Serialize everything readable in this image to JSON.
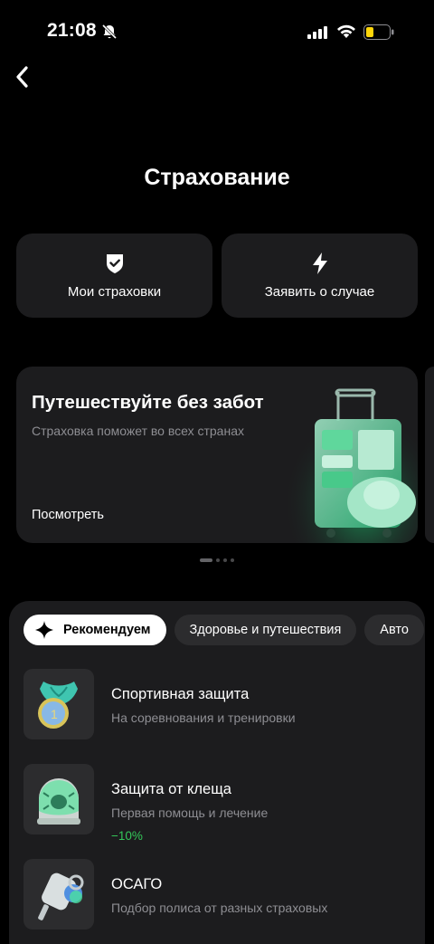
{
  "status": {
    "time": "21:08"
  },
  "page": {
    "title": "Страхование"
  },
  "actions": [
    {
      "label": "Мои страховки",
      "icon": "shield-check-icon"
    },
    {
      "label": "Заявить о случае",
      "icon": "lightning-icon"
    }
  ],
  "promo": {
    "title": "Путешествуйте без забот",
    "subtitle": "Страховка поможет во всех странах",
    "link": "Посмотреть",
    "image": "suitcase-illustration"
  },
  "pager": {
    "total": 4,
    "active": 1
  },
  "tabs": [
    {
      "label": "Рекомендуем",
      "active": true,
      "icon": "sparkle-icon"
    },
    {
      "label": "Здоровье и путешествия",
      "active": false
    },
    {
      "label": "Авто",
      "active": false
    }
  ],
  "products": [
    {
      "title": "Спортивная защита",
      "subtitle": "На соревнования и тренировки",
      "badge": "",
      "image": "medal-icon"
    },
    {
      "title": "Защита от клеща",
      "subtitle": "Первая помощь и лечение",
      "badge": "−10%",
      "image": "tick-dome-icon"
    },
    {
      "title": "ОСАГО",
      "subtitle": "Подбор полиса от разных страховых",
      "badge": "",
      "image": "car-key-icon"
    }
  ],
  "colors": {
    "background": "#000000",
    "card": "#1c1c1e",
    "chip": "#2c2c2e",
    "accent_green": "#34c759",
    "secondary_text": "#8e8e93"
  }
}
